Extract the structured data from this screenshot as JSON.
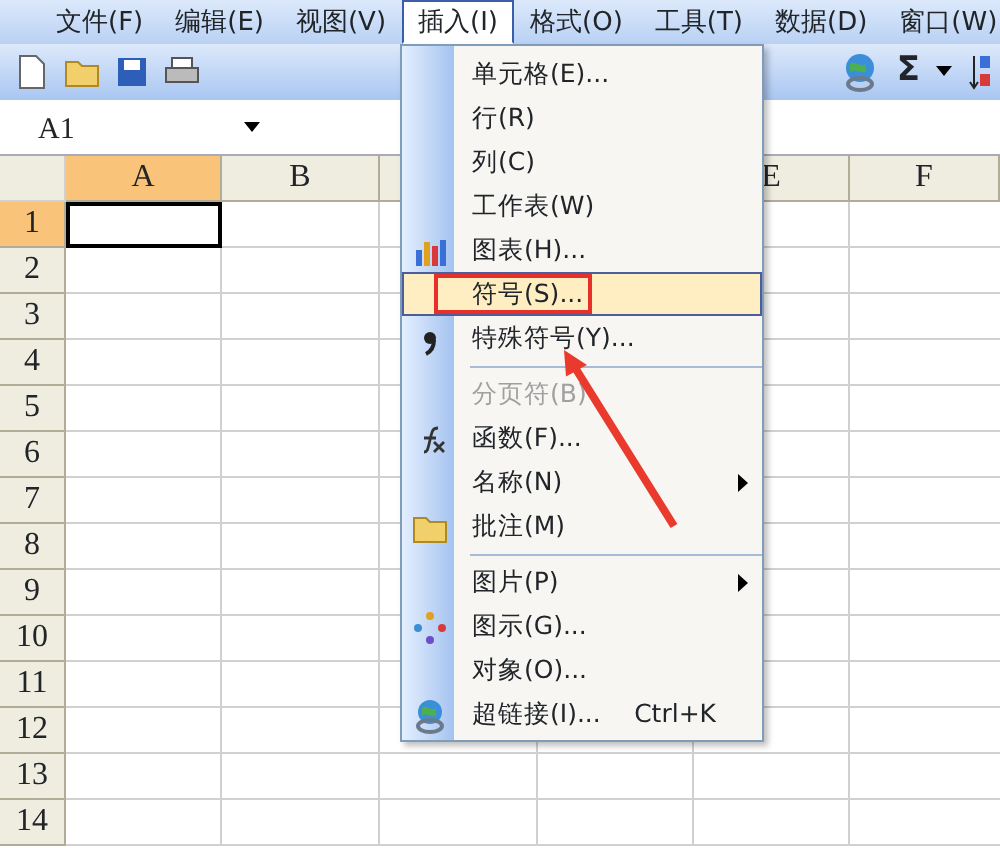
{
  "menubar": [
    {
      "label": "文件(F)",
      "selected": false
    },
    {
      "label": "编辑(E)",
      "selected": false
    },
    {
      "label": "视图(V)",
      "selected": false
    },
    {
      "label": "插入(I)",
      "selected": true
    },
    {
      "label": "格式(O)",
      "selected": false
    },
    {
      "label": "工具(T)",
      "selected": false
    },
    {
      "label": "数据(D)",
      "selected": false
    },
    {
      "label": "窗口(W)",
      "selected": false
    }
  ],
  "toolbar": {
    "sum_symbol": "Σ"
  },
  "name_box": {
    "value": "A1"
  },
  "sheet": {
    "columns": [
      {
        "label": "A",
        "selected": true
      },
      {
        "label": "B",
        "selected": false
      },
      {
        "label": "E",
        "selected": false
      },
      {
        "label": "F",
        "selected": false
      }
    ],
    "rows": [
      {
        "label": "1",
        "selected": true
      },
      {
        "label": "2",
        "selected": false
      },
      {
        "label": "3",
        "selected": false
      },
      {
        "label": "4",
        "selected": false
      },
      {
        "label": "5",
        "selected": false
      },
      {
        "label": "6",
        "selected": false
      },
      {
        "label": "7",
        "selected": false
      },
      {
        "label": "8",
        "selected": false
      },
      {
        "label": "9",
        "selected": false
      },
      {
        "label": "10",
        "selected": false
      },
      {
        "label": "11",
        "selected": false
      },
      {
        "label": "12",
        "selected": false
      },
      {
        "label": "13",
        "selected": false
      },
      {
        "label": "14",
        "selected": false
      }
    ]
  },
  "insert_menu": {
    "items": [
      {
        "kind": "item",
        "label": "单元格(E)...",
        "selected": false,
        "disabled": false
      },
      {
        "kind": "item",
        "label": "行(R)",
        "selected": false,
        "disabled": false
      },
      {
        "kind": "item",
        "label": "列(C)",
        "selected": false,
        "disabled": false
      },
      {
        "kind": "item",
        "label": "工作表(W)",
        "selected": false,
        "disabled": false
      },
      {
        "kind": "item",
        "label": "图表(H)...",
        "selected": false,
        "disabled": false
      },
      {
        "kind": "item",
        "label": "符号(S)...",
        "selected": true,
        "disabled": false
      },
      {
        "kind": "item",
        "label": "特殊符号(Y)...",
        "selected": false,
        "disabled": false
      },
      {
        "kind": "separator"
      },
      {
        "kind": "item",
        "label": "分页符(B)",
        "selected": false,
        "disabled": true
      },
      {
        "kind": "item",
        "label": "函数(F)...",
        "selected": false,
        "disabled": false
      },
      {
        "kind": "item",
        "label": "名称(N)",
        "submenu": true,
        "selected": false,
        "disabled": false
      },
      {
        "kind": "item",
        "label": "批注(M)",
        "selected": false,
        "disabled": false
      },
      {
        "kind": "separator"
      },
      {
        "kind": "item",
        "label": "图片(P)",
        "submenu": true,
        "selected": false,
        "disabled": false
      },
      {
        "kind": "item",
        "label": "图示(G)...",
        "selected": false,
        "disabled": false
      },
      {
        "kind": "item",
        "label": "对象(O)...",
        "selected": false,
        "disabled": false
      },
      {
        "kind": "item",
        "label": "超链接(I)...",
        "shortcut": "Ctrl+K",
        "selected": false,
        "disabled": false
      }
    ]
  }
}
